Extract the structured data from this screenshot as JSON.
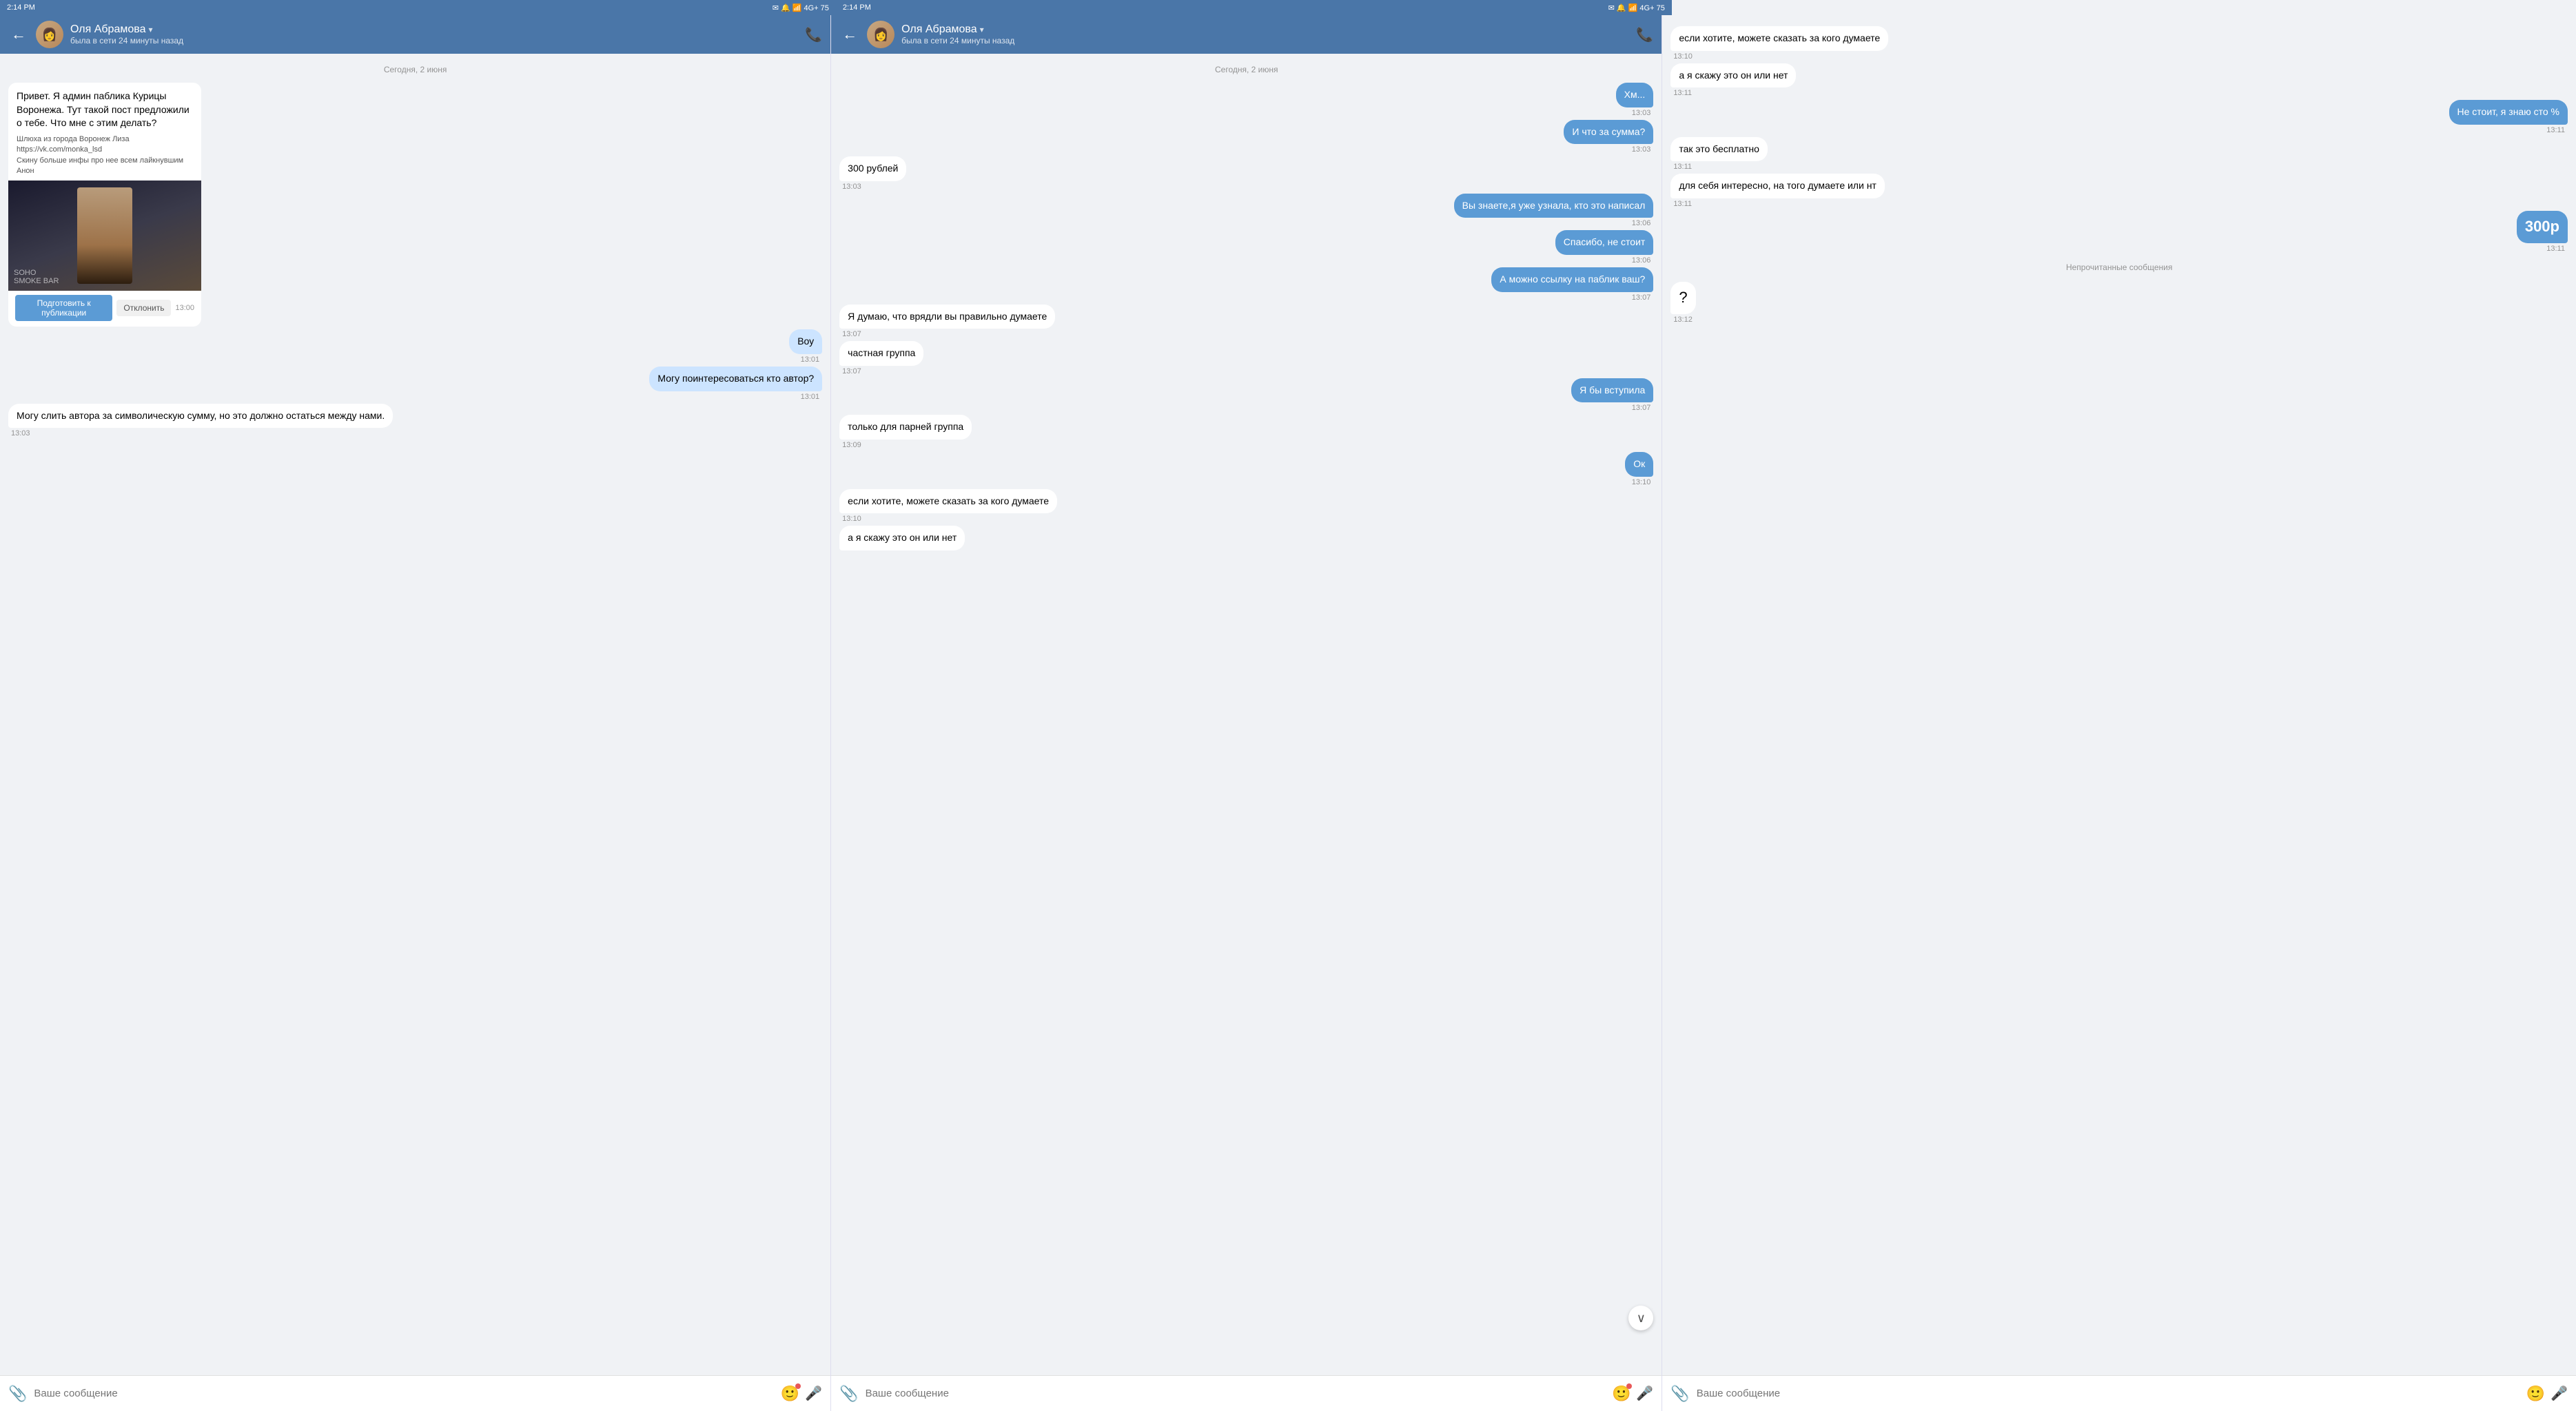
{
  "statusBar": {
    "time": "2:14 PM",
    "icons": "✉ 🔔 📶",
    "battery": "75",
    "signal": "4G+"
  },
  "contact": {
    "name": "Оля Абрамова",
    "status": "была в сети 24 минуты назад",
    "chevron": "▾"
  },
  "dateDivider": "Сегодня, 2 июня",
  "leftPane": {
    "messages": [
      {
        "id": "msg1",
        "type": "card",
        "text": "Привет. Я админ паблика Курицы Воронежа. Тут такой пост предложили о тебе. Что мне с этим делать?",
        "meta1": "Шлюха из города Воронеж Лиза https://vk.com/monka_lsd",
        "meta2": "Скину больше инфы про нее всем лайкнувшим",
        "meta3": "Анон",
        "btnPublish": "Подготовить к публикации",
        "btnDecline": "Отклонить",
        "time": "13:00",
        "direction": "incoming"
      },
      {
        "id": "msg2",
        "type": "text",
        "text": "Воу",
        "time": "13:01",
        "direction": "outgoing"
      },
      {
        "id": "msg3",
        "type": "text",
        "text": "Могу поинтересоваться кто автор?",
        "time": "13:01",
        "direction": "outgoing"
      },
      {
        "id": "msg4",
        "type": "text",
        "text": "Могу слить автора за символическую сумму, но это должно остаться между нами.",
        "time": "13:03",
        "direction": "incoming"
      }
    ],
    "input": {
      "placeholder": "Ваше сообщение"
    }
  },
  "middlePane": {
    "messages": [
      {
        "id": "m1",
        "text": "Хм...",
        "time": "13:03",
        "direction": "outgoing"
      },
      {
        "id": "m2",
        "text": "И что за сумма?",
        "time": "13:03",
        "direction": "outgoing"
      },
      {
        "id": "m3",
        "text": "300 рублей",
        "time": "13:03",
        "direction": "incoming"
      },
      {
        "id": "m4",
        "text": "Вы знаете,я уже узнала, кто это написал",
        "time": "13:06",
        "direction": "outgoing"
      },
      {
        "id": "m5",
        "text": "Спасибо, не стоит",
        "time": "13:06",
        "direction": "outgoing"
      },
      {
        "id": "m6",
        "text": "А можно ссылку на паблик ваш?",
        "time": "13:07",
        "direction": "outgoing"
      },
      {
        "id": "m7",
        "text": "Я думаю, что врядли вы правильно думаете",
        "time": "13:07",
        "direction": "incoming"
      },
      {
        "id": "m8",
        "text": "частная группа",
        "time": "13:07",
        "direction": "incoming"
      },
      {
        "id": "m9",
        "text": "Я бы вступила",
        "time": "13:07",
        "direction": "outgoing"
      },
      {
        "id": "m10",
        "text": "только для парней группа",
        "time": "13:09",
        "direction": "incoming"
      },
      {
        "id": "m11",
        "text": "Ок",
        "time": "13:10",
        "direction": "outgoing"
      },
      {
        "id": "m12",
        "text": "если хотите, можете сказать за кого думаете",
        "time": "13:10",
        "direction": "incoming"
      },
      {
        "id": "m13",
        "text": "а я скажу это он или нет",
        "time": "",
        "direction": "incoming"
      }
    ],
    "input": {
      "placeholder": "Ваше сообщение"
    }
  },
  "rightPane": {
    "messages": [
      {
        "id": "r1",
        "text": "если хотите, можете сказать за кого думаете",
        "time": "13:10",
        "direction": "incoming"
      },
      {
        "id": "r2",
        "text": "а я скажу это он или нет",
        "time": "13:11",
        "direction": "incoming"
      },
      {
        "id": "r3",
        "text": "Не стоит, я знаю сто %",
        "time": "13:11",
        "direction": "outgoing"
      },
      {
        "id": "r4",
        "text": "так это бесплатно",
        "time": "13:11",
        "direction": "incoming"
      },
      {
        "id": "r5",
        "text": "для себя интересно, на того думаете или нт",
        "time": "13:11",
        "direction": "incoming"
      },
      {
        "id": "r6",
        "text": "300р",
        "time": "13:11",
        "direction": "outgoing"
      },
      {
        "id": "r7",
        "text": "Непрочитанные сообщения",
        "type": "divider"
      },
      {
        "id": "r8",
        "text": "?",
        "time": "13:12",
        "direction": "incoming"
      }
    ],
    "input": {
      "placeholder": "Ваше сообщение"
    }
  },
  "buttons": {
    "back": "←",
    "call": "📞",
    "attach": "📎",
    "emoji": "🙂",
    "mic": "🎤",
    "scrollDown": "∨"
  }
}
